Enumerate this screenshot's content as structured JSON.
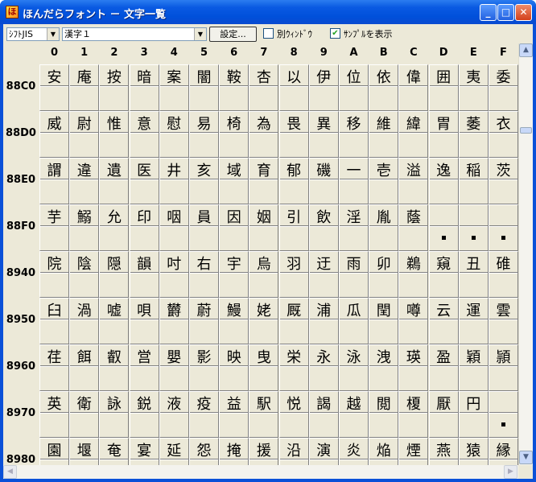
{
  "window": {
    "title": "ほんだらフォント － 文字一覧",
    "icon": "app-icon"
  },
  "toolbar": {
    "encoding_value": "ｼﾌﾄJIS",
    "block_value": "漢字１",
    "settings_label": "設定...",
    "separate_window_label": "別ｳｨﾝﾄﾞｳ",
    "separate_window_checked": false,
    "show_sample_label": "ｻﾝﾌﾟﾙを表示",
    "show_sample_checked": true
  },
  "columns": [
    "0",
    "1",
    "2",
    "3",
    "4",
    "5",
    "6",
    "7",
    "8",
    "9",
    "A",
    "B",
    "C",
    "D",
    "E",
    "F"
  ],
  "rows": [
    {
      "label": "88C0",
      "chars": [
        "安",
        "庵",
        "按",
        "暗",
        "案",
        "闇",
        "鞍",
        "杏",
        "以",
        "伊",
        "位",
        "依",
        "偉",
        "囲",
        "夷",
        "委"
      ],
      "dots": []
    },
    {
      "label": "88D0",
      "chars": [
        "威",
        "尉",
        "惟",
        "意",
        "慰",
        "易",
        "椅",
        "為",
        "畏",
        "異",
        "移",
        "維",
        "緯",
        "胃",
        "萎",
        "衣"
      ],
      "dots": []
    },
    {
      "label": "88E0",
      "chars": [
        "謂",
        "違",
        "遺",
        "医",
        "井",
        "亥",
        "域",
        "育",
        "郁",
        "磯",
        "一",
        "壱",
        "溢",
        "逸",
        "稲",
        "茨"
      ],
      "dots": []
    },
    {
      "label": "88F0",
      "chars": [
        "芋",
        "鰯",
        "允",
        "印",
        "咽",
        "員",
        "因",
        "姻",
        "引",
        "飲",
        "淫",
        "胤",
        "蔭",
        "",
        "",
        ""
      ],
      "dots": [
        13,
        14,
        15
      ]
    },
    {
      "label": "8940",
      "chars": [
        "院",
        "陰",
        "隠",
        "韻",
        "吋",
        "右",
        "宇",
        "烏",
        "羽",
        "迂",
        "雨",
        "卯",
        "鵜",
        "窺",
        "丑",
        "碓"
      ],
      "dots": []
    },
    {
      "label": "8950",
      "chars": [
        "臼",
        "渦",
        "嘘",
        "唄",
        "欝",
        "蔚",
        "鰻",
        "姥",
        "厩",
        "浦",
        "瓜",
        "閏",
        "噂",
        "云",
        "運",
        "雲"
      ],
      "dots": []
    },
    {
      "label": "8960",
      "chars": [
        "荏",
        "餌",
        "叡",
        "営",
        "嬰",
        "影",
        "映",
        "曳",
        "栄",
        "永",
        "泳",
        "洩",
        "瑛",
        "盈",
        "穎",
        "頴"
      ],
      "dots": []
    },
    {
      "label": "8970",
      "chars": [
        "英",
        "衛",
        "詠",
        "鋭",
        "液",
        "疫",
        "益",
        "駅",
        "悦",
        "謁",
        "越",
        "閲",
        "榎",
        "厭",
        "円",
        ""
      ],
      "dots": [
        15
      ]
    },
    {
      "label": "8980",
      "chars": [
        "園",
        "堰",
        "奄",
        "宴",
        "延",
        "怨",
        "掩",
        "援",
        "沿",
        "演",
        "炎",
        "焔",
        "煙",
        "燕",
        "猿",
        "縁"
      ],
      "dots": []
    }
  ],
  "icons": {
    "minimize": "minimize-icon",
    "maximize": "maximize-icon",
    "close": "close-icon",
    "scroll_up": "scroll-up-arrow-icon",
    "scroll_down": "scroll-down-arrow-icon",
    "scroll_left": "scroll-left-arrow-icon",
    "scroll_right": "scroll-right-arrow-icon"
  }
}
